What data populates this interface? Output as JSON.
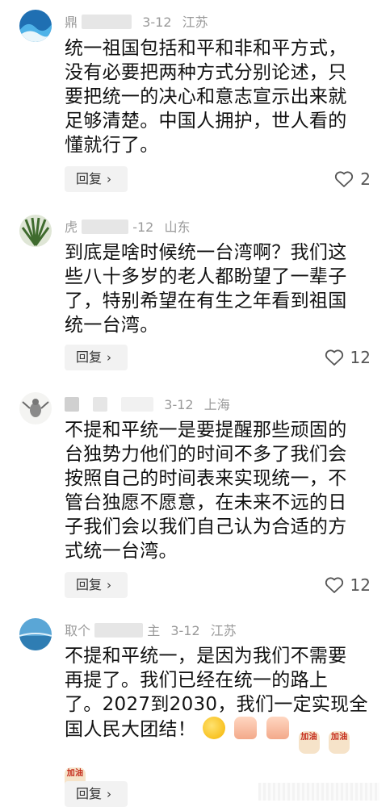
{
  "comments": [
    {
      "user": "鼎",
      "date": "3-12",
      "location": "江苏",
      "lines": [
        "统一祖国包括和平和非和平方式，",
        "没有必要把两种方式分别论述，只",
        "要把统一的决心和意志宣示出来就",
        "足够清楚。中国人拥护，世人看的",
        "懂就行了。"
      ],
      "reply_label": "回复",
      "likes": "2",
      "avatar_icon": "ocean-wave-avatar"
    },
    {
      "user": "虎",
      "date": "-12",
      "location": "山东",
      "lines": [
        "到底是啥时候统一台湾啊？我们这",
        "些八十多岁的老人都盼望了一辈子",
        "了，特别希望在有生之年看到祖国",
        "统一台湾。"
      ],
      "reply_label": "回复",
      "likes": "12",
      "avatar_icon": "plant-avatar"
    },
    {
      "user": "",
      "date": "3-12",
      "location": "上海",
      "lines": [
        "不提和平统一是要提醒那些顽固的",
        "台独势力他们的时间不多了我们会",
        "按照自己的时间表来实现统一，不",
        "管台独愿不愿意，在未来不远的日",
        "子我们会以我们自己认为合适的方",
        "式统一台湾。"
      ],
      "reply_label": "回复",
      "likes": "12",
      "avatar_icon": "bird-avatar"
    },
    {
      "user": "取个",
      "user_suffix": "主",
      "date": "3-12",
      "location": "江苏",
      "lines": [
        "不提和平统一，是因为我们不需要",
        "再提了。我们已经在统一的路上",
        "了。2027到2030，我们一定实现全",
        "国人民大团结！"
      ],
      "jiayou_label": "加油",
      "reply_label": "回复",
      "avatar_icon": "sea-landscape-avatar"
    }
  ],
  "icons": {
    "reply_chevron": "chevron-right-icon",
    "like": "heart-outline-icon"
  }
}
